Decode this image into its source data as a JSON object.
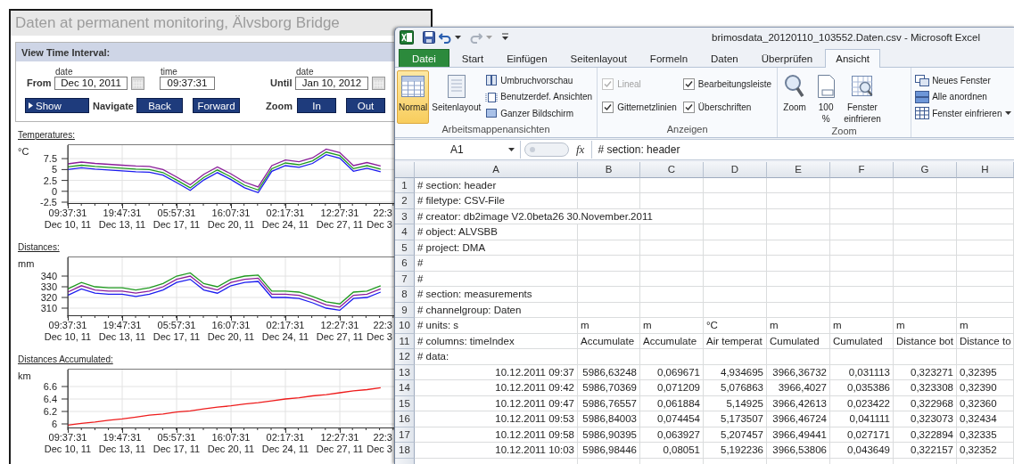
{
  "monitor": {
    "title": "Daten at permanent monitoring, Älvsborg Bridge",
    "interval_panel": {
      "heading": "View Time Interval:",
      "from_label": "From",
      "from_date_caption": "date",
      "from_date": "Dec 10, 2011",
      "time_caption": "time",
      "from_time": "09:37:31",
      "until_label": "Until",
      "until_date_caption": "date",
      "until_date": "Jan 10, 2012",
      "show_button": "Show",
      "navigate_label": "Navigate",
      "back_button": "Back",
      "forward_button": "Forward",
      "zoom_label": "Zoom",
      "zoom_in_button": "In",
      "zoom_out_button": "Out"
    },
    "charts": [
      {
        "cut_tick_label": "22:3\nDec 3",
        "chart_data": {
          "type": "line",
          "title": "Temperatures:",
          "ylabel": "°C",
          "grid": true,
          "categories": [
            "09:37:31\nDec 10, 11",
            null,
            null,
            null,
            "19:47:31\nDec 13, 11",
            null,
            null,
            null,
            "05:57:31\nDec 17, 11",
            null,
            null,
            null,
            "16:07:31\nDec 20, 11",
            null,
            null,
            null,
            "02:17:31\nDec 24, 11",
            null,
            null,
            null,
            "12:27:31\nDec 27, 11",
            null,
            null,
            null
          ],
          "ylim": [
            -2.7,
            10.8
          ],
          "yticks": [
            7.5,
            5,
            2.5,
            0,
            -2.5
          ],
          "series": [
            {
              "color": "#1f9a1f",
              "values": [
                5.6,
                6,
                5.7,
                5.5,
                5.3,
                5.1,
                5,
                4.3,
                2.6,
                0.8,
                3.2,
                4.9,
                3.3,
                1.4,
                0.3,
                5.2,
                6.5,
                6.1,
                7,
                9,
                8.2,
                5.2,
                5.9,
                5.1
              ]
            },
            {
              "color": "#8b1d9a",
              "values": [
                6.3,
                6.7,
                6.4,
                6.2,
                6,
                5.8,
                5.7,
                5,
                3.3,
                1.5,
                3.9,
                5.6,
                4,
                2.1,
                1,
                5.9,
                7.2,
                6.8,
                7.7,
                9.7,
                8.9,
                5.9,
                6.6,
                5.8
              ]
            },
            {
              "color": "#1c1cf0",
              "values": [
                5,
                5.4,
                5.1,
                4.9,
                4.7,
                4.5,
                4.4,
                3.7,
                2,
                0.2,
                2.6,
                4.3,
                2.7,
                0.8,
                -0.3,
                4.6,
                5.9,
                5.5,
                6.4,
                8.4,
                7.6,
                4.6,
                5.3,
                4.5
              ]
            }
          ]
        }
      },
      {
        "cut_tick_label": "22:3\nDec 3",
        "chart_data": {
          "type": "line",
          "title": "Distances:",
          "ylabel": "mm",
          "grid": true,
          "categories": [
            "09:37:31\nDec 10, 11",
            null,
            null,
            null,
            "19:47:31\nDec 13, 11",
            null,
            null,
            null,
            "05:57:31\nDec 17, 11",
            null,
            null,
            null,
            "16:07:31\nDec 20, 11",
            null,
            null,
            null,
            "02:17:31\nDec 24, 11",
            null,
            null,
            null,
            "12:27:31\nDec 27, 11",
            null,
            null,
            null
          ],
          "ylim": [
            303.3,
            358.3
          ],
          "yticks": [
            340,
            330,
            320,
            310
          ],
          "series": [
            {
              "color": "#1f9a1f",
              "values": [
                328,
                334,
                330,
                329,
                329,
                327,
                329,
                333,
                340,
                343,
                333,
                330,
                337,
                340,
                341,
                326,
                326,
                325,
                321,
                316,
                314,
                325,
                326,
                331
              ]
            },
            {
              "color": "#8b1d9a",
              "values": [
                325,
                331,
                327,
                326,
                326,
                324,
                326,
                330,
                337,
                340,
                330,
                327,
                334,
                337,
                338,
                323,
                323,
                322,
                318,
                313,
                311,
                322,
                323,
                328
              ]
            },
            {
              "color": "#1c1cf0",
              "values": [
                322,
                328,
                324,
                323,
                323,
                321,
                323,
                327,
                334,
                337,
                327,
                324,
                331,
                334,
                335,
                320,
                320,
                319,
                315,
                310,
                308,
                319,
                320,
                325
              ]
            }
          ]
        }
      },
      {
        "cut_tick_label": "22:3\nDec 3",
        "chart_data": {
          "type": "line",
          "title": "Distances Accumulated:",
          "ylabel": "km",
          "grid": true,
          "categories": [
            "09:37:31\nDec 10, 11",
            null,
            null,
            null,
            "19:47:31\nDec 13, 11",
            null,
            null,
            null,
            "05:57:31\nDec 17, 11",
            null,
            null,
            null,
            "16:07:31\nDec 20, 11",
            null,
            null,
            null,
            "02:17:31\nDec 24, 11",
            null,
            null,
            null,
            "12:27:31\nDec 27, 11",
            null,
            null,
            null
          ],
          "ylim": [
            5.943,
            6.886
          ],
          "yticks": [
            6.6,
            6.4,
            6.2,
            6
          ],
          "series": [
            {
              "color": "#ee1c1c",
              "values": [
                5.98,
                6.01,
                6.03,
                6.06,
                6.08,
                6.11,
                6.14,
                6.16,
                6.19,
                6.21,
                6.24,
                6.27,
                6.29,
                6.32,
                6.34,
                6.37,
                6.4,
                6.42,
                6.45,
                6.47,
                6.5,
                6.53,
                6.55,
                6.58
              ]
            }
          ]
        }
      }
    ]
  },
  "excel": {
    "title": "brimosdata_20120110_103552.Daten.csv  -  Microsoft Excel",
    "tabs": [
      {
        "label": "Datei",
        "kind": "file",
        "selected": false
      },
      {
        "label": "Start",
        "kind": "tab",
        "selected": false
      },
      {
        "label": "Einfügen",
        "kind": "tab",
        "selected": false
      },
      {
        "label": "Seitenlayout",
        "kind": "tab",
        "selected": false
      },
      {
        "label": "Formeln",
        "kind": "tab",
        "selected": false
      },
      {
        "label": "Daten",
        "kind": "tab",
        "selected": false
      },
      {
        "label": "Überprüfen",
        "kind": "tab",
        "selected": false
      },
      {
        "label": "Ansicht",
        "kind": "tab",
        "selected": true
      }
    ],
    "ribbon_groups": [
      {
        "label": "Arbeitsmappenansichten",
        "items": [
          {
            "kind": "large",
            "label": "Normal",
            "selected": true
          },
          {
            "kind": "large",
            "label": "Seitenlayout",
            "selected": false
          },
          {
            "kind": "small",
            "label": "Umbruchvorschau",
            "selected": false
          },
          {
            "kind": "small",
            "label": "Benutzerdef. Ansichten",
            "selected": false
          },
          {
            "kind": "small",
            "label": "Ganzer Bildschirm",
            "selected": false
          }
        ]
      },
      {
        "label": "Anzeigen",
        "items": [
          {
            "kind": "checkbox",
            "label": "Lineal",
            "checked": true,
            "disabled": true
          },
          {
            "kind": "checkbox",
            "label": "Gitternetzlinien",
            "checked": true,
            "disabled": false
          },
          {
            "kind": "checkbox",
            "label": "Bearbeitungsleiste",
            "checked": true,
            "disabled": false
          },
          {
            "kind": "checkbox",
            "label": "Überschriften",
            "checked": true,
            "disabled": false
          }
        ]
      },
      {
        "label": "Zoom",
        "items": [
          {
            "kind": "large",
            "label": "Zoom"
          },
          {
            "kind": "large",
            "label": "100\n%"
          },
          {
            "kind": "large",
            "label": "Fenster\neinfrieren"
          }
        ]
      },
      {
        "items": [
          {
            "kind": "small",
            "label": "Neues Fenster"
          },
          {
            "kind": "small",
            "label": "Alle anordnen"
          },
          {
            "kind": "dropdown",
            "label": "Fenster einfrieren"
          }
        ]
      }
    ],
    "name_box": "A1",
    "function_symbol": "fx",
    "formula": "# section: header",
    "columns": [
      "A",
      "B",
      "C",
      "D",
      "E",
      "F",
      "G",
      "H"
    ],
    "rows": [
      {
        "number": "1",
        "kind": "text",
        "cells": [
          "# section: header"
        ]
      },
      {
        "number": "2",
        "kind": "text",
        "cells": [
          "# filetype: CSV-File"
        ]
      },
      {
        "number": "3",
        "kind": "text",
        "cells": [
          "# creator: db2image V2.0beta26 30.November.2011"
        ]
      },
      {
        "number": "4",
        "kind": "text",
        "cells": [
          "# object: ALVSBB"
        ]
      },
      {
        "number": "5",
        "kind": "text",
        "cells": [
          "# project: DMA"
        ]
      },
      {
        "number": "6",
        "kind": "text",
        "cells": [
          "#"
        ]
      },
      {
        "number": "7",
        "kind": "text",
        "cells": [
          "#"
        ]
      },
      {
        "number": "8",
        "kind": "text",
        "cells": [
          "# section: measurements"
        ]
      },
      {
        "number": "9",
        "kind": "text",
        "cells": [
          "# channelgroup: Daten"
        ]
      },
      {
        "number": "10",
        "kind": "text",
        "cells": [
          "# units: s",
          "m",
          "m",
          "°C",
          "m",
          "m",
          "m",
          "m"
        ]
      },
      {
        "number": "11",
        "kind": "text",
        "cells": [
          "# columns: timeIndex",
          "Accumulate",
          "Accumulate",
          "Air temperat",
          "Cumulated",
          "Cumulated",
          "Distance bot",
          "Distance to"
        ]
      },
      {
        "number": "12",
        "kind": "text",
        "cells": [
          "# data:"
        ]
      },
      {
        "number": "13",
        "kind": "numeric",
        "cells": [
          "10.12.2011 09:37",
          "5986,63248",
          "0,069671",
          "4,934695",
          "3966,36732",
          "0,031113",
          "0,323271",
          "0,32395"
        ]
      },
      {
        "number": "14",
        "kind": "numeric",
        "cells": [
          "10.12.2011 09:42",
          "5986,70369",
          "0,071209",
          "5,076863",
          "3966,4027",
          "0,035386",
          "0,323308",
          "0,32390"
        ]
      },
      {
        "number": "15",
        "kind": "numeric",
        "cells": [
          "10.12.2011 09:47",
          "5986,76557",
          "0,061884",
          "5,14925",
          "3966,42613",
          "0,023422",
          "0,322968",
          "0,32360"
        ]
      },
      {
        "number": "16",
        "kind": "numeric",
        "cells": [
          "10.12.2011 09:53",
          "5986,84003",
          "0,074454",
          "5,173507",
          "3966,46724",
          "0,041111",
          "0,323073",
          "0,32434"
        ]
      },
      {
        "number": "17",
        "kind": "numeric",
        "cells": [
          "10.12.2011 09:58",
          "5986,90395",
          "0,063927",
          "5,207457",
          "3966,49441",
          "0,027171",
          "0,322894",
          "0,32335"
        ]
      },
      {
        "number": "18",
        "kind": "numeric",
        "cells": [
          "10.12.2011 10:03",
          "5986,98446",
          "0,08051",
          "5,192236",
          "3966,53806",
          "0,043649",
          "0,322157",
          "0,32352"
        ]
      }
    ]
  }
}
